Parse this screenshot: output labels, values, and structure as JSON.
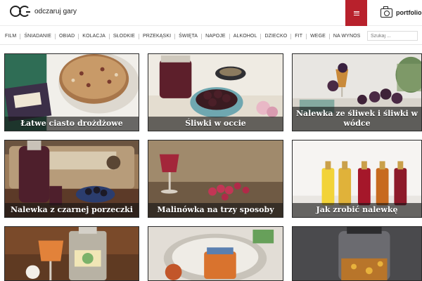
{
  "header": {
    "site_name": "odczaruj gary",
    "portfolio_label": "portfolio"
  },
  "nav": {
    "items": [
      "FILM",
      "ŚNIADANIE",
      "OBIAD",
      "KOLACJA",
      "SŁODKIE",
      "PRZEKĄSKI",
      "ŚWIĘTA",
      "NAPOJE",
      "ALKOHOL",
      "DZIECKO",
      "FIT",
      "WEGE",
      "NA WYNOS"
    ],
    "search_placeholder": "Szukaj ..."
  },
  "cards": [
    {
      "title": "Łatwe ciasto drożdżowe"
    },
    {
      "title": "Śliwki w occie"
    },
    {
      "title": "Nalewka ze śliwek i śliwki w wódce"
    },
    {
      "title": "Nalewka z czarnej porzeczki"
    },
    {
      "title": "Malinówka na trzy sposoby"
    },
    {
      "title": "Jak zrobić nalewkę"
    },
    {
      "title": ""
    },
    {
      "title": ""
    },
    {
      "title": ""
    }
  ],
  "colors": {
    "accent": "#b8212c"
  }
}
